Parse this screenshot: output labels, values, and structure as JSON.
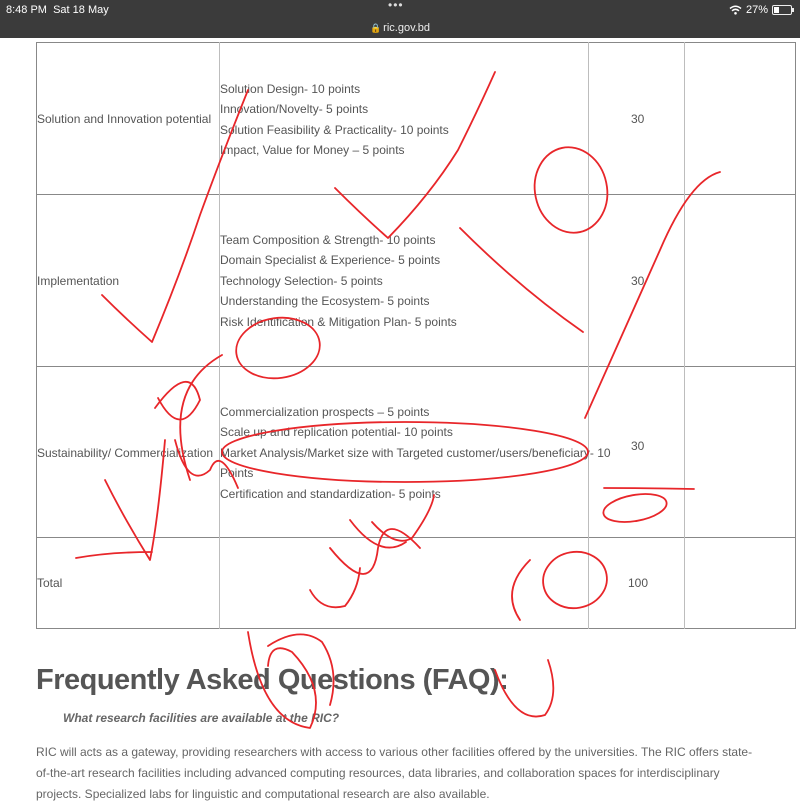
{
  "status_bar": {
    "time": "8:48 PM",
    "date": "Sat 18 May",
    "menu_dots": "•••",
    "url": "ric.gov.bd",
    "battery": "27%",
    "wifi_icon": "wifi-icon",
    "lock_icon": "lock-icon",
    "battery_icon": "battery-icon"
  },
  "table": {
    "rows": [
      {
        "criterion": "Solution and Innovation potential",
        "details": [
          "Solution Design- 10 points",
          "Innovation/Novelty- 5 points",
          "Solution Feasibility & Practicality- 10 points",
          "Impact, Value for Money – 5 points"
        ],
        "score": "30"
      },
      {
        "criterion": "Implementation",
        "details": [
          "Team Composition & Strength- 10 points",
          "Domain Specialist & Experience- 5 points",
          "Technology Selection- 5 points",
          "Understanding the Ecosystem- 5 points",
          "Risk Identification & Mitigation Plan- 5 points"
        ],
        "score": "30"
      },
      {
        "criterion": "Sustainability/ Commercialization",
        "details": [
          "Commercialization prospects – 5 points",
          "Scale up and replication potential- 10 points",
          "Market Analysis/Market size with Targeted customer/users/beneficiary- 10",
          "Points",
          "Certification and standardization- 5 points"
        ],
        "score": "30"
      },
      {
        "criterion": "Total",
        "details": [],
        "score": "100"
      }
    ]
  },
  "faq": {
    "heading": "Frequently Asked Questions (FAQ):",
    "question": "What research facilities are available at the RIC?",
    "answer": "RIC will acts as a gateway, providing researchers with access to various other facilities offered by the universities. The RIC offers state-of-the-art research facilities including advanced computing resources, data libraries, and collaboration spaces for interdisciplinary projects. Specialized labs for linguistic and computational research are also available."
  },
  "annotation_color": "#e8262a"
}
